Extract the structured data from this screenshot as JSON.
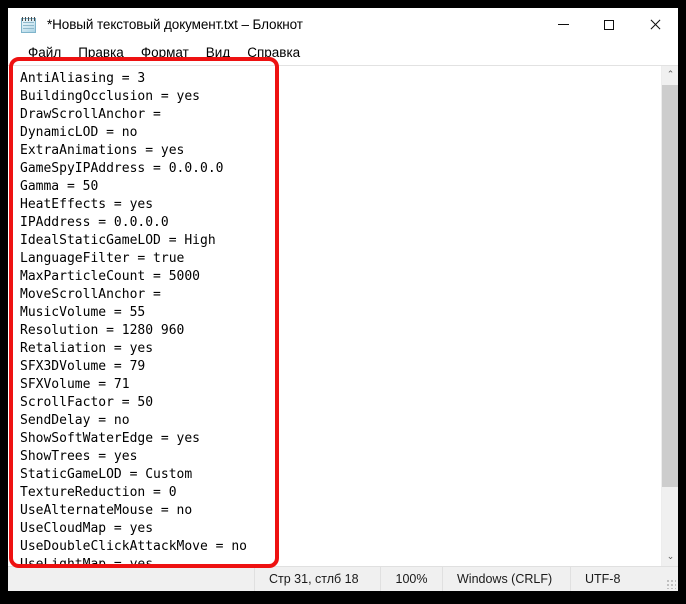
{
  "window": {
    "title": "*Новый текстовый документ.txt – Блокнот",
    "icon": "notepad-icon",
    "controls": {
      "minimize": "—",
      "maximize": "□",
      "close": "✕"
    }
  },
  "menubar": {
    "items": [
      {
        "label": "Файл"
      },
      {
        "label": "Правка"
      },
      {
        "label": "Формат"
      },
      {
        "label": "Вид"
      },
      {
        "label": "Справка"
      }
    ]
  },
  "editor": {
    "lines": [
      "AntiAliasing = 3",
      "BuildingOcclusion = yes",
      "DrawScrollAnchor = ",
      "DynamicLOD = no",
      "ExtraAnimations = yes",
      "GameSpyIPAddress = 0.0.0.0",
      "Gamma = 50",
      "HeatEffects = yes",
      "IPAddress = 0.0.0.0",
      "IdealStaticGameLOD = High",
      "LanguageFilter = true",
      "MaxParticleCount = 5000",
      "MoveScrollAnchor = ",
      "MusicVolume = 55",
      "Resolution = 1280 960",
      "Retaliation = yes",
      "SFX3DVolume = 79",
      "SFXVolume = 71",
      "ScrollFactor = 50",
      "SendDelay = no",
      "ShowSoftWaterEdge = yes",
      "ShowTrees = yes",
      "StaticGameLOD = Custom",
      "TextureReduction = 0",
      "UseAlternateMouse = no",
      "UseCloudMap = yes",
      "UseDoubleClickAttackMove = no",
      "UseLightMap = yes"
    ]
  },
  "scrollbar": {
    "up_arrow": "⌃",
    "down_arrow": "⌄"
  },
  "statusbar": {
    "position": "Стр 31, стлб 18",
    "zoom": "100%",
    "line_ending": "Windows (CRLF)",
    "encoding": "UTF-8"
  },
  "annotation": {
    "color": "#ee1111",
    "shape": "rounded-rectangle"
  }
}
